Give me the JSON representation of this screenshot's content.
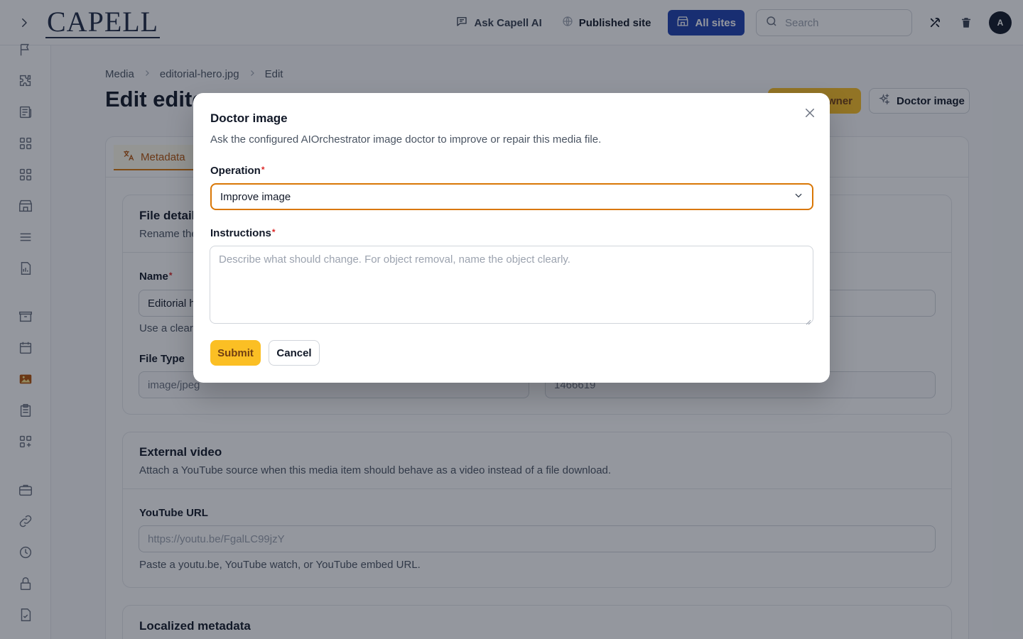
{
  "app": {
    "logo_text": "CAPELL"
  },
  "topbar": {
    "ask_ai": "Ask Capell AI",
    "published_site": "Published site",
    "all_sites": "All sites",
    "search_placeholder": "Search",
    "avatar_initial": "A"
  },
  "sidebar": {
    "icons": [
      "flag-icon",
      "puzzle-icon",
      "newspaper-icon",
      "grid-icon",
      "grid-icon",
      "building-storefront-icon",
      "menu-lines-icon",
      "document-chart-icon",
      "archive-box-icon",
      "calendar-icon",
      "photo-icon",
      "clipboard-list-icon",
      "squares-plus-icon",
      "briefcase-icon",
      "link-icon",
      "clock-icon",
      "lock-icon",
      "document-check-icon"
    ],
    "active": "photo-icon"
  },
  "breadcrumb": {
    "items": [
      "Media",
      "editorial-hero.jpg",
      "Edit"
    ]
  },
  "page": {
    "title": "Edit edito",
    "header_button_partial": "wner",
    "doctor_image_button": "Doctor image"
  },
  "tabs": {
    "active_label": "Metadata"
  },
  "file_details": {
    "title": "File detail",
    "desc": "Rename the",
    "name_label": "Name",
    "name_value": "Editorial h",
    "name_help": "Use a clear",
    "file_type_label": "File Type",
    "file_type_value": "image/jpeg",
    "size_value": "1466619"
  },
  "external_video": {
    "title": "External video",
    "desc": "Attach a YouTube source when this media item should behave as a video instead of a file download.",
    "url_label": "YouTube URL",
    "url_placeholder": "https://youtu.be/FgalLC99jzY",
    "url_help": "Paste a youtu.be, YouTube watch, or YouTube embed URL."
  },
  "localized": {
    "title": "Localized metadata"
  },
  "modal": {
    "title": "Doctor image",
    "desc": "Ask the configured AIOrchestrator image doctor to improve or repair this media file.",
    "operation_label": "Operation",
    "operation_value": "Improve image",
    "instructions_label": "Instructions",
    "instructions_placeholder": "Describe what should change. For object removal, name the object clearly.",
    "submit": "Submit",
    "cancel": "Cancel",
    "required_mark": "*"
  },
  "colors": {
    "accent": "#fbbf24",
    "brand_blue": "#1e40af",
    "focus_ring": "#d97706"
  }
}
